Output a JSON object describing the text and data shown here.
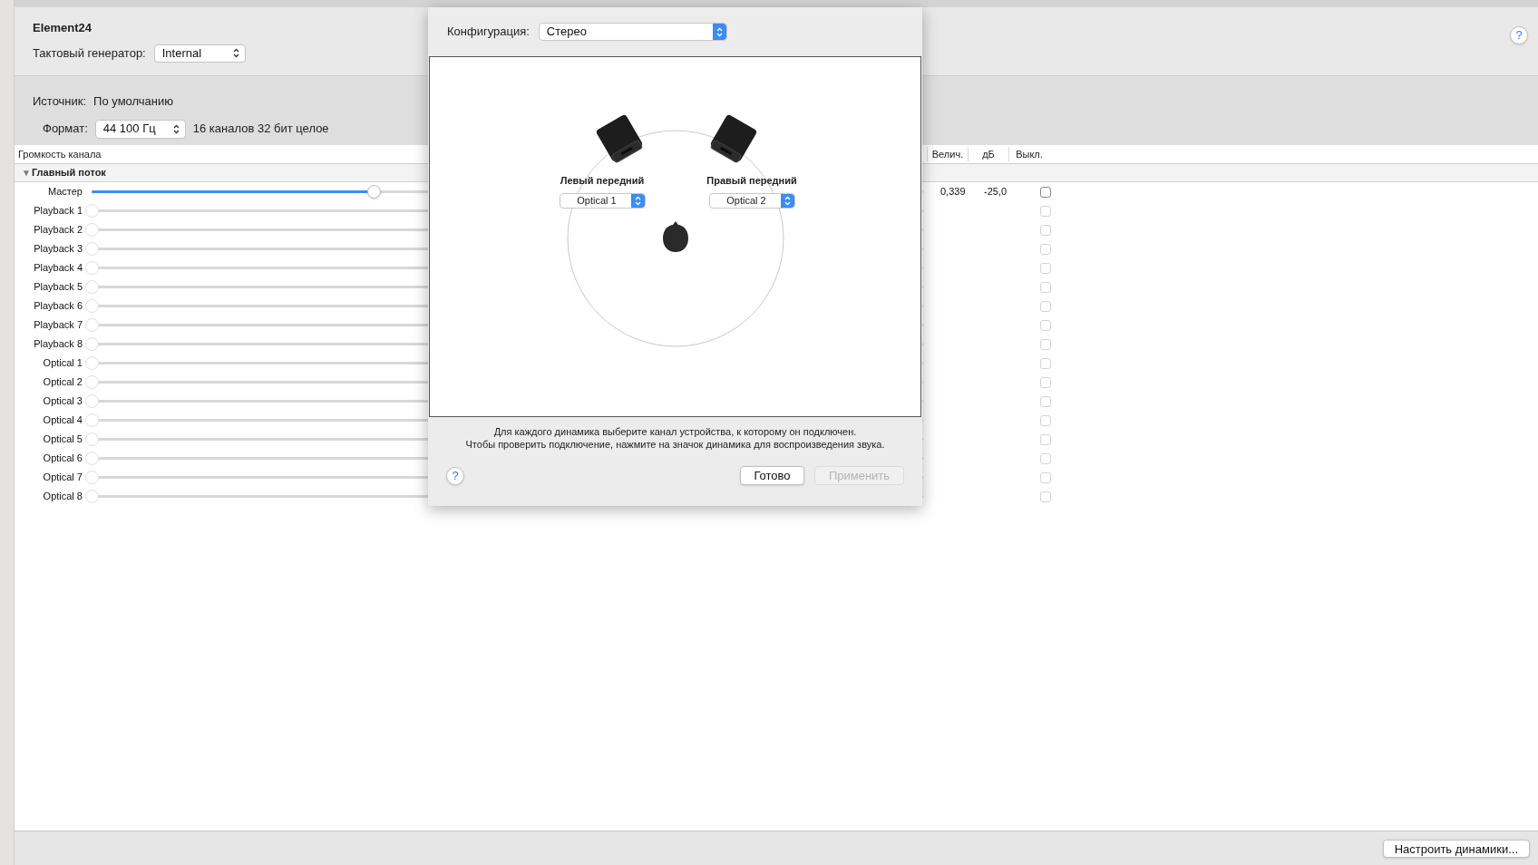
{
  "device": {
    "name": "Element24",
    "clock_label": "Тактовый генератор:",
    "clock_value": "Internal"
  },
  "stream": {
    "source_label": "Источник:",
    "source_value": "По умолчанию",
    "format_label": "Формат:",
    "format_value": "44 100 Гц",
    "format_desc": "16 каналов 32 бит целое"
  },
  "help_button": "?",
  "table": {
    "columns": [
      "Громкость канала",
      "Велич.",
      "дБ",
      "Выкл."
    ],
    "group": {
      "toggle": "▼",
      "label": "Главный поток",
      "expanded": true
    },
    "rows": [
      {
        "name": "Мастер",
        "disabled": false,
        "level": 0.339,
        "value": "0,339",
        "db": "-25,0",
        "muted": false
      },
      {
        "name": "Playback 1",
        "disabled": true,
        "level": 0,
        "muted": false
      },
      {
        "name": "Playback 2",
        "disabled": true,
        "level": 0,
        "muted": false
      },
      {
        "name": "Playback 3",
        "disabled": true,
        "level": 0,
        "muted": false
      },
      {
        "name": "Playback 4",
        "disabled": true,
        "level": 0,
        "muted": false
      },
      {
        "name": "Playback 5",
        "disabled": true,
        "level": 0,
        "muted": false
      },
      {
        "name": "Playback 6",
        "disabled": true,
        "level": 0,
        "muted": false
      },
      {
        "name": "Playback 7",
        "disabled": true,
        "level": 0,
        "muted": false
      },
      {
        "name": "Playback 8",
        "disabled": true,
        "level": 0,
        "muted": false
      },
      {
        "name": "Optical 1",
        "disabled": true,
        "level": 0,
        "muted": false
      },
      {
        "name": "Optical 2",
        "disabled": true,
        "level": 0,
        "muted": false
      },
      {
        "name": "Optical 3",
        "disabled": true,
        "level": 0,
        "muted": false
      },
      {
        "name": "Optical 4",
        "disabled": true,
        "level": 0,
        "muted": false
      },
      {
        "name": "Optical 5",
        "disabled": true,
        "level": 0,
        "muted": false
      },
      {
        "name": "Optical 6",
        "disabled": true,
        "level": 0,
        "muted": false
      },
      {
        "name": "Optical 7",
        "disabled": true,
        "level": 0,
        "muted": false
      },
      {
        "name": "Optical 8",
        "disabled": true,
        "level": 0,
        "muted": false
      }
    ]
  },
  "footer": {
    "button": "Настроить динамики..."
  },
  "dialog": {
    "config_label": "Конфигурация:",
    "config_value": "Стерео",
    "speakers": [
      {
        "label": "Левый передний",
        "channel": "Optical 1"
      },
      {
        "label": "Правый передний",
        "channel": "Optical 2"
      }
    ],
    "hint": [
      "Для каждого динамика выберите канал устройства, к которому он подключен.",
      "Чтобы проверить подключение, нажмите на значок динамика для воспроизведения звука."
    ],
    "help": "?",
    "buttons": [
      {
        "label": "Готово",
        "disabled": false
      },
      {
        "label": "Применить",
        "disabled": true
      }
    ]
  }
}
